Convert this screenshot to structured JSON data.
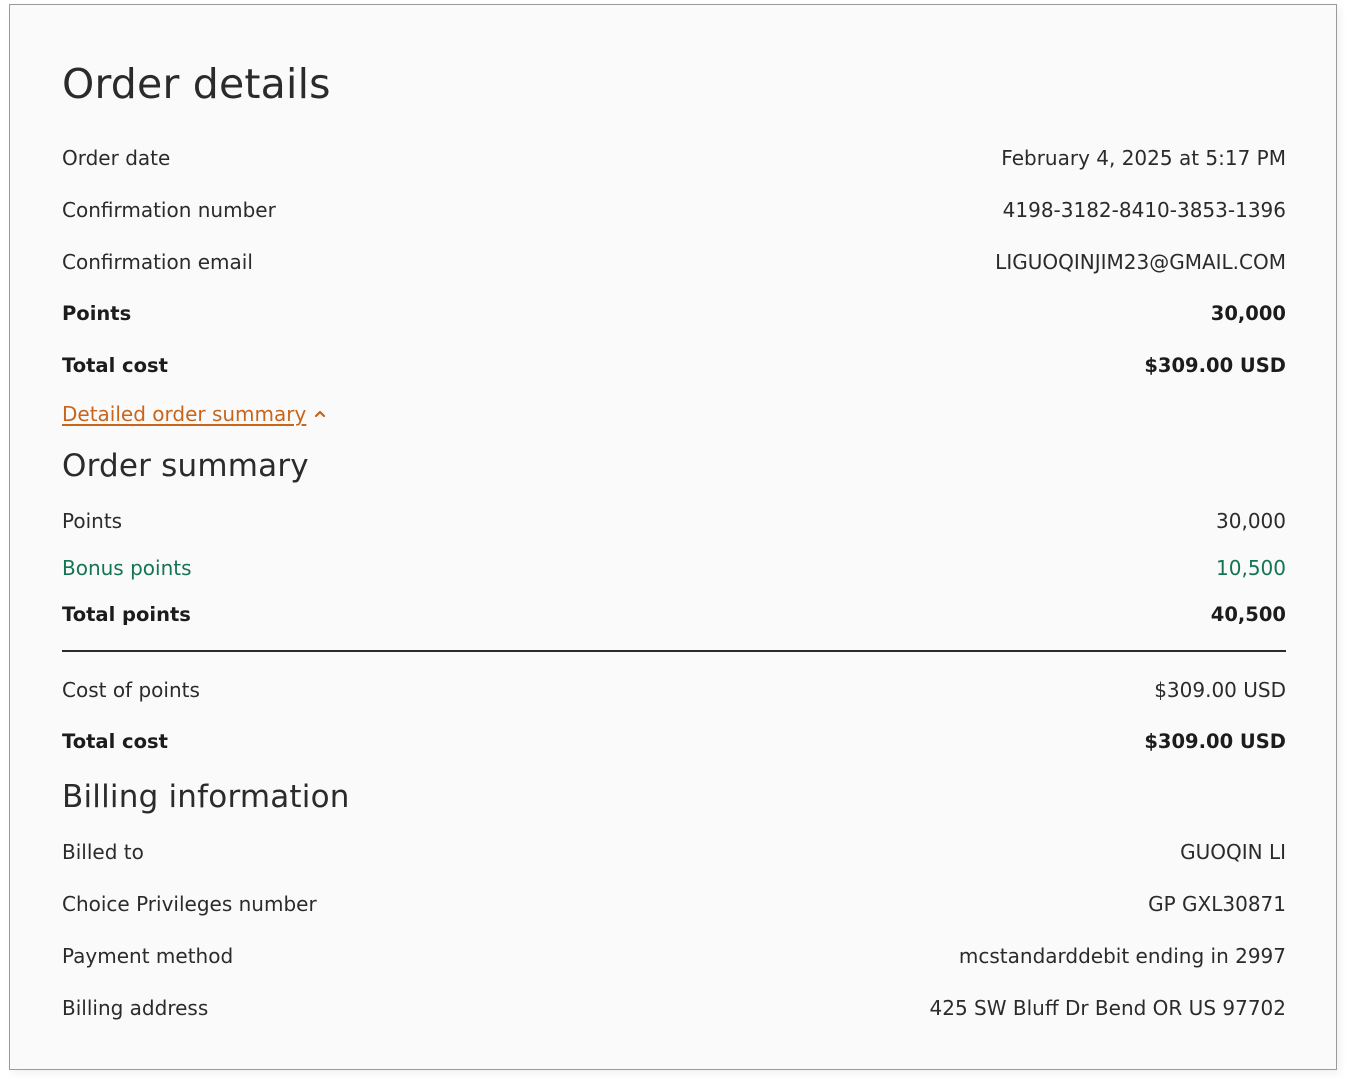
{
  "order_details": {
    "title": "Order details",
    "rows": [
      {
        "label": "Order date",
        "value": "February 4, 2025 at 5:17 PM"
      },
      {
        "label": "Confirmation number",
        "value": "4198-3182-8410-3853-1396"
      },
      {
        "label": "Confirmation email",
        "value": "LIGUOQINJIM23@GMAIL.COM"
      },
      {
        "label": "Points",
        "value": "30,000"
      },
      {
        "label": "Total cost",
        "value": "$309.00 USD"
      }
    ],
    "toggle_label": "Detailed order summary",
    "toggle_icon": "chevron-up-icon",
    "link_color": "#c8651b"
  },
  "order_summary": {
    "title": "Order summary",
    "points": {
      "label": "Points",
      "value": "30,000"
    },
    "bonus_points": {
      "label": "Bonus points",
      "value": "10,500"
    },
    "total_points": {
      "label": "Total points",
      "value": "40,500"
    },
    "cost_of_points": {
      "label": "Cost of points",
      "value": "$309.00 USD"
    },
    "total_cost": {
      "label": "Total cost",
      "value": "$309.00 USD"
    },
    "bonus_color": "#137552"
  },
  "billing": {
    "title": "Billing information",
    "rows": [
      {
        "label": "Billed to",
        "value": "GUOQIN LI"
      },
      {
        "label": "Choice Privileges number",
        "value": "GP GXL30871"
      },
      {
        "label": "Payment method",
        "value": "mcstandarddebit ending in 2997"
      },
      {
        "label": "Billing address",
        "value": "425 SW Bluff Dr Bend OR US 97702"
      }
    ]
  }
}
